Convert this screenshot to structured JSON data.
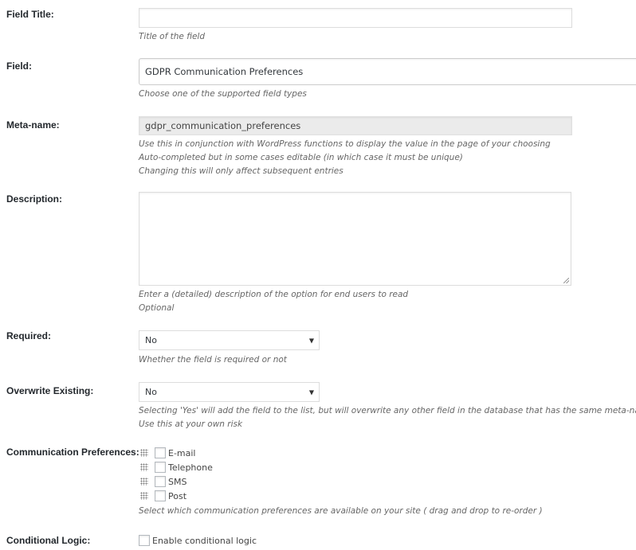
{
  "fields": {
    "field_title": {
      "label": "Field Title:",
      "value": "",
      "hint": "Title of the field"
    },
    "field": {
      "label": "Field:",
      "value": "GDPR Communication Preferences",
      "hint": "Choose one of the supported field types"
    },
    "meta_name": {
      "label": "Meta-name:",
      "value": "gdpr_communication_preferences",
      "hints": [
        "Use this in conjunction with WordPress functions to display the value in the page of your choosing",
        "Auto-completed but in some cases editable (in which case it must be unique)",
        "Changing this will only affect subsequent entries"
      ]
    },
    "description": {
      "label": "Description:",
      "value": "",
      "hints": [
        "Enter a (detailed) description of the option for end users to read",
        "Optional"
      ]
    },
    "required": {
      "label": "Required:",
      "value": "No",
      "arrow": "▼",
      "hint": "Whether the field is required or not"
    },
    "overwrite_existing": {
      "label": "Overwrite Existing:",
      "value": "No",
      "arrow": "▼",
      "hints": [
        "Selecting 'Yes' will add the field to the list, but will overwrite any other field in the database that has the same meta-name",
        "Use this at your own risk"
      ]
    },
    "communication_preferences": {
      "label": "Communication Preferences:",
      "options": [
        {
          "label": "E-mail",
          "checked": false
        },
        {
          "label": "Telephone",
          "checked": false
        },
        {
          "label": "SMS",
          "checked": false
        },
        {
          "label": "Post",
          "checked": false
        }
      ],
      "hint": "Select which communication preferences are available on your site ( drag and drop to re-order )"
    },
    "conditional_logic": {
      "label": "Conditional Logic:",
      "checkbox_label": "Enable conditional logic",
      "checked": false
    }
  }
}
